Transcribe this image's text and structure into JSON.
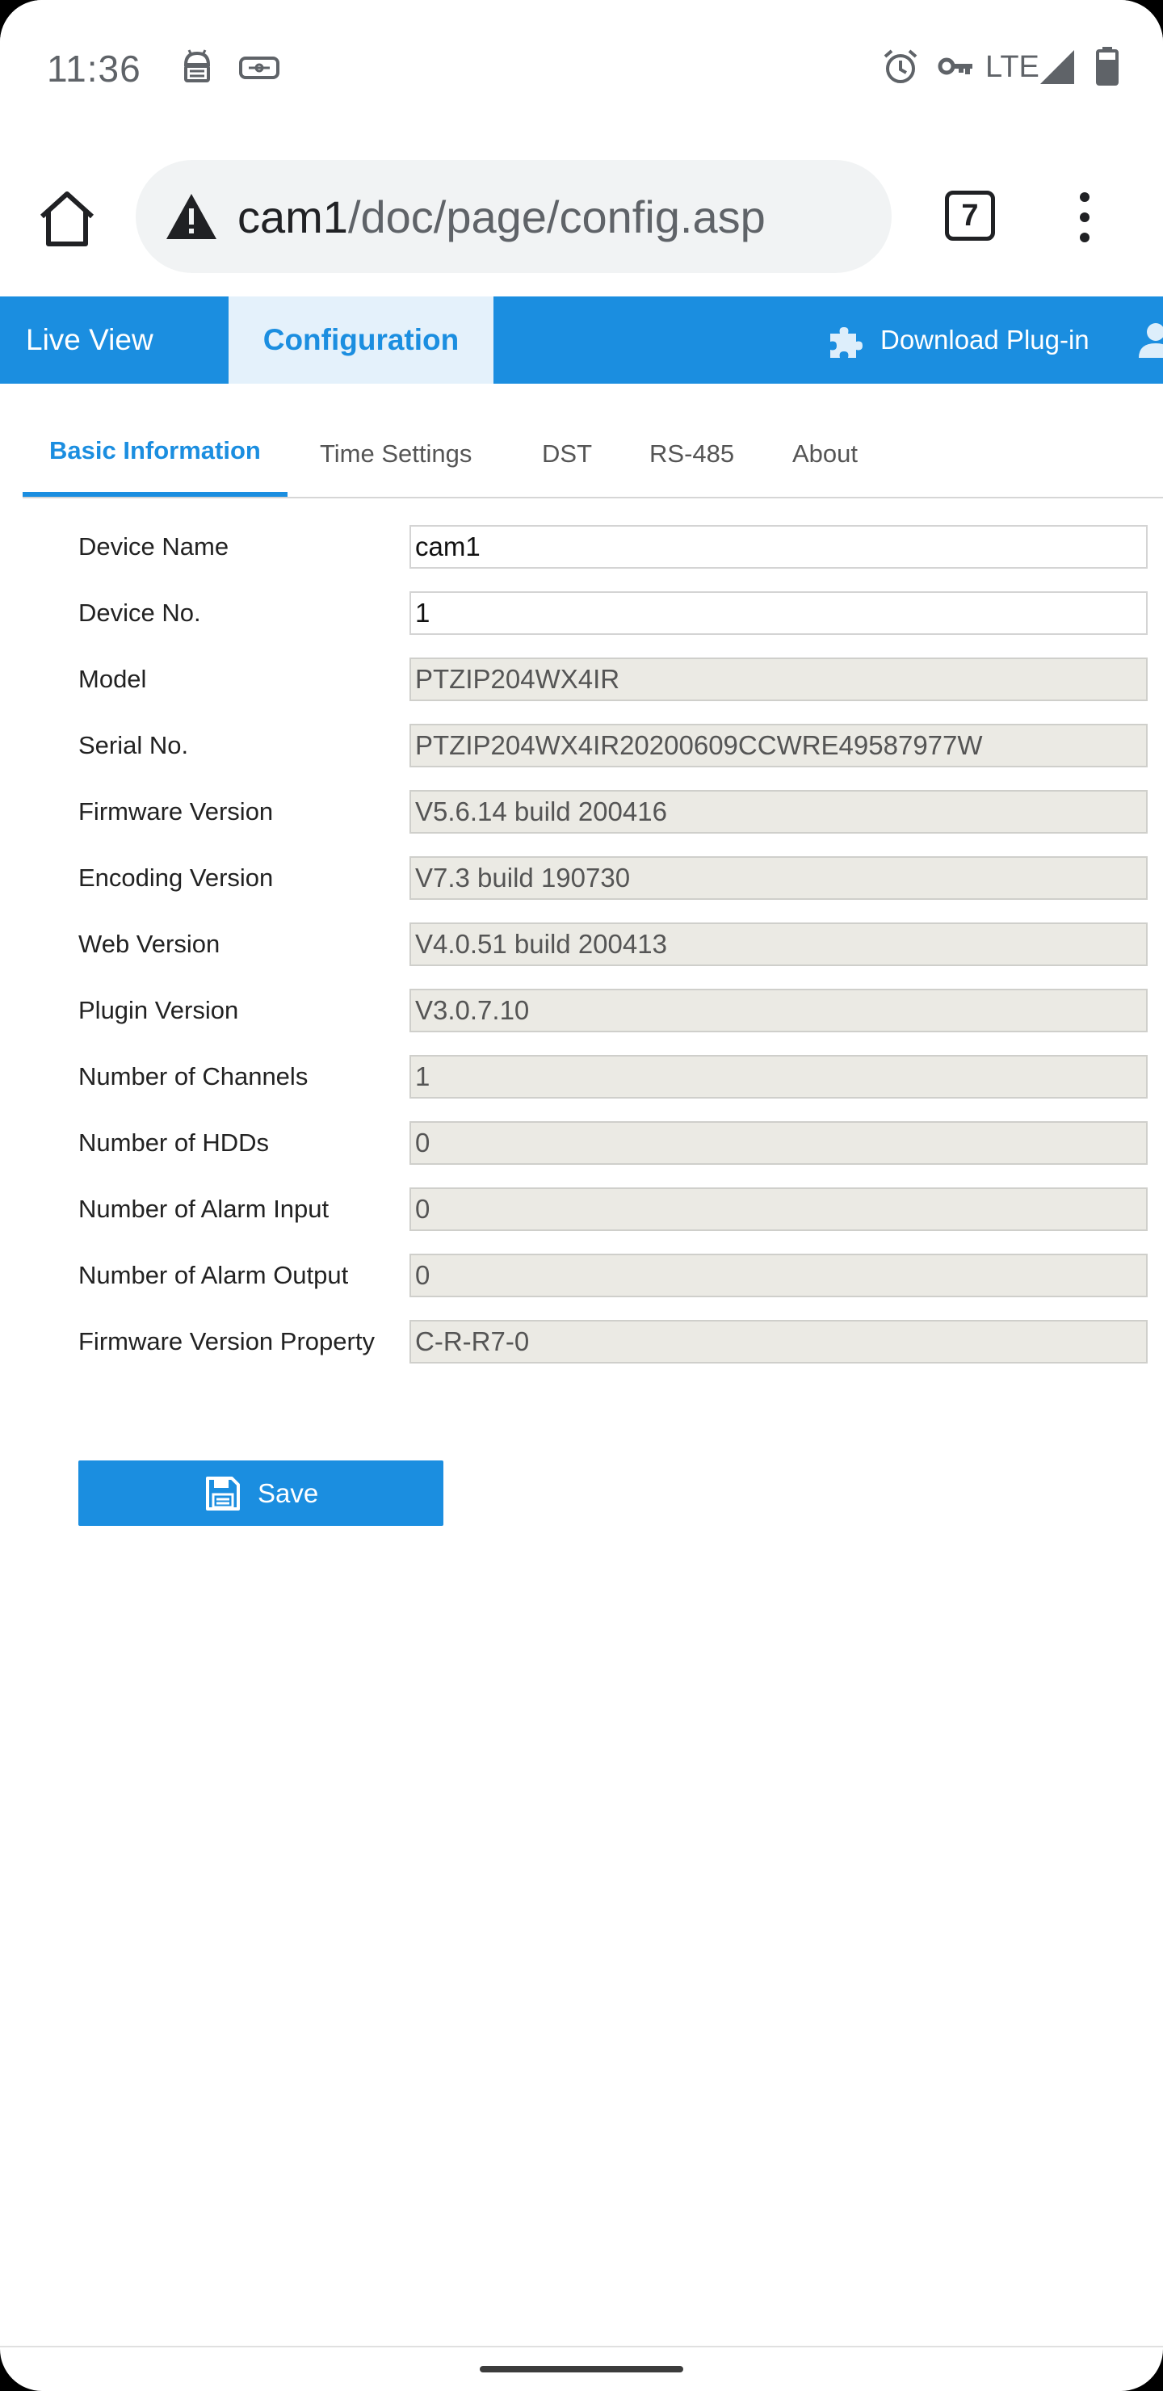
{
  "status_bar": {
    "time": "11:36",
    "network": "LTE",
    "icons": [
      "android-debug-icon",
      "keyboard-icon",
      "alarm-icon",
      "vpn-key-icon",
      "signal-icon",
      "battery-icon"
    ]
  },
  "browser": {
    "url_host": "cam1",
    "url_path": "/doc/page/config.asp",
    "tab_count": "7"
  },
  "app_nav": {
    "live_view": "Live View",
    "configuration": "Configuration",
    "download_plugin": "Download Plug-in"
  },
  "sub_tabs": [
    {
      "label": "Basic Information",
      "active": true
    },
    {
      "label": "Time Settings",
      "active": false
    },
    {
      "label": "DST",
      "active": false
    },
    {
      "label": "RS-485",
      "active": false
    },
    {
      "label": "About",
      "active": false
    }
  ],
  "form": {
    "rows": [
      {
        "label": "Device Name",
        "value": "cam1",
        "editable": true
      },
      {
        "label": "Device No.",
        "value": "1",
        "editable": true
      },
      {
        "label": "Model",
        "value": "PTZIP204WX4IR",
        "editable": false
      },
      {
        "label": "Serial No.",
        "value": "PTZIP204WX4IR20200609CCWRE49587977W",
        "editable": false
      },
      {
        "label": "Firmware Version",
        "value": "V5.6.14 build 200416",
        "editable": false
      },
      {
        "label": "Encoding Version",
        "value": "V7.3 build 190730",
        "editable": false
      },
      {
        "label": "Web Version",
        "value": "V4.0.51 build 200413",
        "editable": false
      },
      {
        "label": "Plugin Version",
        "value": "V3.0.7.10",
        "editable": false
      },
      {
        "label": "Number of Channels",
        "value": "1",
        "editable": false
      },
      {
        "label": "Number of HDDs",
        "value": "0",
        "editable": false
      },
      {
        "label": "Number of Alarm Input",
        "value": "0",
        "editable": false
      },
      {
        "label": "Number of Alarm Output",
        "value": "0",
        "editable": false
      },
      {
        "label": "Firmware Version Property",
        "value": "C-R-R7-0",
        "editable": false
      }
    ],
    "save_label": "Save"
  },
  "colors": {
    "accent": "#1b8ee0",
    "active_tab_bg": "#e4f1fb",
    "readonly_field_bg": "#ebeae4"
  }
}
